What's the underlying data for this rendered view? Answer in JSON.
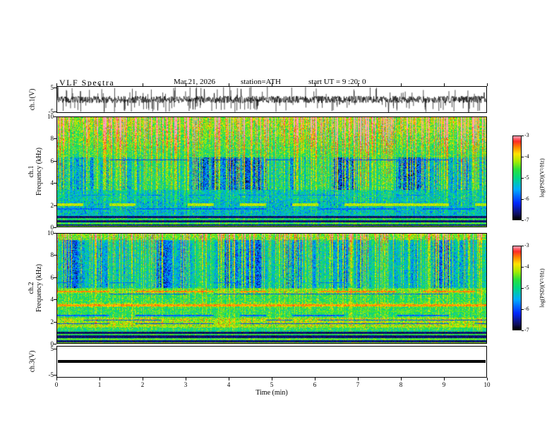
{
  "header": {
    "title": "VLF  Spectra",
    "date": "Mar.21, 2026",
    "station": "station=ATH",
    "start_ut": "start UT =  9 :20: 0"
  },
  "xaxis": {
    "label": "Time  (min)",
    "lim": [
      0,
      10
    ],
    "ticks": [
      0,
      1,
      2,
      3,
      4,
      5,
      6,
      7,
      8,
      9,
      10
    ]
  },
  "colormap": [
    [
      0.0,
      "#000000"
    ],
    [
      0.07,
      "#0f0f64"
    ],
    [
      0.2,
      "#0028ff"
    ],
    [
      0.36,
      "#00aaff"
    ],
    [
      0.5,
      "#00d782"
    ],
    [
      0.6,
      "#28e13c"
    ],
    [
      0.7,
      "#aaeb00"
    ],
    [
      0.79,
      "#ffe100"
    ],
    [
      0.87,
      "#ff8200"
    ],
    [
      0.94,
      "#ff2828"
    ],
    [
      1.0,
      "#ffa5b9"
    ]
  ],
  "chart_data": [
    {
      "id": "ch1_waveform",
      "type": "line",
      "ylabel": "ch.1(V)",
      "ylim": [
        -5,
        5
      ],
      "yticks": [
        5,
        -5
      ],
      "xlim": [
        0,
        10
      ],
      "seed": 13,
      "description": "Broadband VLF time-series: ~1 V amplitude noise around 0 V with dense impulsive sferic spikes reaching the +/-5 V limits over the full 10 minutes."
    },
    {
      "id": "ch1_spectrogram",
      "type": "heatmap",
      "ylabel_lines": [
        "ch.1",
        "Frequency  (kHz)"
      ],
      "ylim": [
        0,
        10
      ],
      "yticks": [
        0,
        2,
        4,
        6,
        8,
        10
      ],
      "xlim": [
        0,
        10
      ],
      "zlim": [
        -7,
        -3
      ],
      "colorbar_label": "log(PSD)(V²/Hz)",
      "colorbar_ticks": [
        -3,
        -4,
        -5,
        -6,
        -7
      ],
      "seed": 101,
      "description": "Green (~1e-5) broadband background with vertical sferic striations; yellow-red enhancement above ~7 kHz; dark-blue depleted patches 3.5-6 kHz; intermittent yellow line near 2 kHz; black low-PSD horizontal bands below 1 kHz.",
      "features": {
        "base": -4.9,
        "noise": 0.65,
        "streak_density": 0.45,
        "streak_max": 1.9,
        "top_boost": {
          "from": 6.5,
          "amount": 0.7
        },
        "blue_region": {
          "from": 3.35,
          "to": 6.3,
          "depth": 1.5
        },
        "dim_bands": [
          {
            "from": 0.95,
            "to": 2.3,
            "amount": 0.55
          },
          {
            "from": 2.3,
            "to": 3.35,
            "amount": 0.45
          }
        ],
        "lines": [
          {
            "khz": 2.0,
            "width": 0.22,
            "level": -4.15,
            "duty": 0.55
          },
          {
            "khz": 1.62,
            "width": 0.08,
            "level": -5.9,
            "duty": 0.7
          },
          {
            "khz": 6.1,
            "width": 0.08,
            "level": -6.1,
            "duty": 0.45
          },
          {
            "khz": 2.85,
            "width": 0.07,
            "level": -5.8,
            "duty": 0.5
          }
        ],
        "dark_bands": [
          [
            0.0,
            0.2
          ],
          [
            0.4,
            0.6
          ],
          [
            0.75,
            0.95
          ]
        ],
        "bright_lines": [
          {
            "khz": 0.03,
            "level": -4.4
          },
          {
            "khz": 0.3,
            "level": -4.5
          },
          {
            "khz": 0.68,
            "level": -4.8
          },
          {
            "khz": 1.05,
            "level": -5.3
          }
        ]
      }
    },
    {
      "id": "ch2_spectrogram",
      "type": "heatmap",
      "ylabel_lines": [
        "ch.2",
        "Frequency  (kHz)"
      ],
      "ylim": [
        0,
        10
      ],
      "yticks": [
        0,
        2,
        4,
        6,
        8,
        10
      ],
      "xlim": [
        0,
        10
      ],
      "zlim": [
        -7,
        -3
      ],
      "colorbar_label": "log(PSD)(V²/Hz)",
      "colorbar_ticks": [
        -3,
        -4,
        -5,
        -6,
        -7
      ],
      "seed": 202,
      "description": "Green background with sferic striations; blue depleted patches 5-9.5 kHz; strong continuous yellow-red line ~3.4 kHz; red dashed line ~4.7 kHz; yellow band 1.4-2.3 kHz cut by dark lines; black horizontal bands below 1 kHz.",
      "features": {
        "base": -4.85,
        "noise": 0.6,
        "streak_density": 0.4,
        "streak_max": 1.6,
        "top_boost": {
          "from": 9.0,
          "amount": 0.5
        },
        "blue_region": {
          "from": 5.0,
          "to": 9.4,
          "depth": 1.2
        },
        "dim_bands": [
          {
            "from": 5.0,
            "to": 9.4,
            "amount": 0.25
          }
        ],
        "bands_boost": [
          {
            "from": 1.4,
            "to": 2.35,
            "amount": 0.55
          },
          {
            "from": 4.5,
            "to": 5.0,
            "amount": 0.3
          },
          {
            "from": 3.3,
            "to": 3.65,
            "amount": 0.3
          }
        ],
        "lines": [
          {
            "khz": 3.45,
            "width": 0.16,
            "level": -3.6,
            "duty": 1
          },
          {
            "khz": 4.72,
            "width": 0.1,
            "level": -3.55,
            "duty": 0.55
          },
          {
            "khz": 4.5,
            "width": 0.08,
            "level": -6.0,
            "duty": 0.6
          },
          {
            "khz": 2.52,
            "width": 0.08,
            "level": -5.9,
            "duty": 0.65
          },
          {
            "khz": 2.9,
            "width": 0.08,
            "level": -4.5,
            "duty": 0.5
          },
          {
            "khz": 1.78,
            "width": 0.09,
            "level": -6.1,
            "duty": 0.85
          },
          {
            "khz": 2.08,
            "width": 0.08,
            "level": -6.0,
            "duty": 0.6
          },
          {
            "khz": 1.5,
            "width": 0.07,
            "level": -4.2,
            "duty": 0.5
          },
          {
            "khz": 5.5,
            "width": 0.07,
            "level": -5.9,
            "duty": 0.35
          }
        ],
        "dark_bands": [
          [
            0.0,
            0.25
          ],
          [
            0.48,
            0.7
          ],
          [
            0.85,
            1.02
          ]
        ],
        "bright_lines": [
          {
            "khz": 0.03,
            "level": -4.3
          },
          {
            "khz": 0.36,
            "level": -4.3
          },
          {
            "khz": 0.78,
            "level": -4.6
          },
          {
            "khz": 1.13,
            "level": -5.1
          }
        ]
      }
    },
    {
      "id": "ch3_waveform",
      "type": "line",
      "ylabel": "ch.3(V)",
      "ylim": [
        -5,
        5
      ],
      "yticks": [
        5,
        -5
      ],
      "xlim": [
        0,
        10
      ],
      "description": "Flat thick black trace at 0 V for the whole interval (channel inactive)."
    }
  ]
}
